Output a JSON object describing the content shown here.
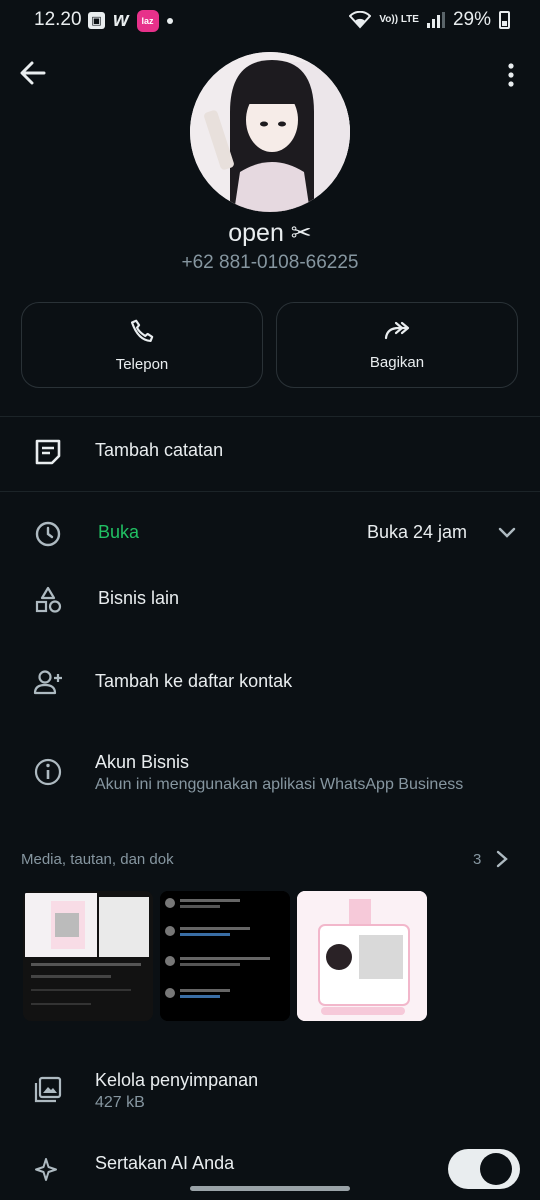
{
  "status": {
    "time": "12.20",
    "volte": "Vo)) LTE",
    "battery": "29%"
  },
  "contact": {
    "name": "open ✂",
    "phone": "+62 881-0108-66225"
  },
  "actions": {
    "call_label": "Telepon",
    "share_label": "Bagikan"
  },
  "rows": {
    "note": "Tambah catatan",
    "hours_status": "Buka",
    "hours_value": "Buka 24 jam",
    "other_business": "Bisnis lain",
    "add_contact": "Tambah ke daftar kontak",
    "business_title": "Akun Bisnis",
    "business_sub": "Akun ini menggunakan aplikasi WhatsApp Business",
    "storage_title": "Kelola penyimpanan",
    "storage_size": "427 kB",
    "ai_title": "Sertakan AI Anda"
  },
  "media": {
    "label": "Media, tautan, dan dok",
    "count": "3"
  },
  "colors": {
    "accent_green": "#21c063",
    "background": "#0b1014",
    "muted": "#8696a0"
  },
  "icons": [
    "back-arrow-icon",
    "more-vert-icon",
    "phone-icon",
    "share-icon",
    "note-icon",
    "clock-icon",
    "shapes-icon",
    "add-person-icon",
    "info-icon",
    "chevron-down-icon",
    "chevron-right-icon",
    "storage-icon",
    "sparkle-icon"
  ]
}
